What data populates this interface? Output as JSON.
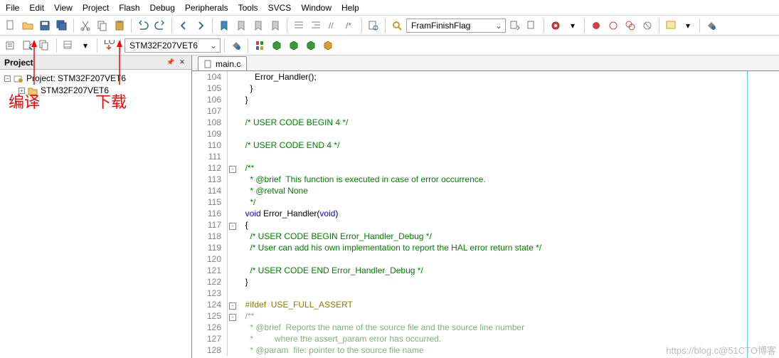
{
  "menu": [
    "File",
    "Edit",
    "View",
    "Project",
    "Flash",
    "Debug",
    "Peripherals",
    "Tools",
    "SVCS",
    "Window",
    "Help"
  ],
  "toolbar2": {
    "target": "STM32F207VET6"
  },
  "search": {
    "text": "FramFinishFlag"
  },
  "project": {
    "panel_title": "Project",
    "root": "Project: STM32F207VET6",
    "child": "STM32F207VET6"
  },
  "ann": {
    "compile": "编译",
    "download": "下载"
  },
  "tab": {
    "file": "main.c"
  },
  "code": [
    {
      "n": 104,
      "f": "",
      "t": "      Error_Handler();",
      "cls": ""
    },
    {
      "n": 105,
      "f": "",
      "t": "    }",
      "cls": ""
    },
    {
      "n": 106,
      "f": "",
      "t": "  }",
      "cls": ""
    },
    {
      "n": 107,
      "f": "",
      "t": "",
      "cls": ""
    },
    {
      "n": 108,
      "f": "",
      "t": "  /* USER CODE BEGIN 4 */",
      "cls": "c-cm"
    },
    {
      "n": 109,
      "f": "",
      "t": "",
      "cls": ""
    },
    {
      "n": 110,
      "f": "",
      "t": "  /* USER CODE END 4 */",
      "cls": "c-cm"
    },
    {
      "n": 111,
      "f": "",
      "t": "",
      "cls": ""
    },
    {
      "n": 112,
      "f": "m",
      "html": "  <span class='c-cm'>/**</span>"
    },
    {
      "n": 113,
      "f": "",
      "html": "  <span class='c-cm'>  * @brief  This function is executed in case of error occurrence.</span>"
    },
    {
      "n": 114,
      "f": "",
      "html": "  <span class='c-cm'>  * @retval None</span>"
    },
    {
      "n": 115,
      "f": "",
      "html": "  <span class='c-cm'>  */</span>"
    },
    {
      "n": 116,
      "f": "",
      "html": "  <span class='c-kw'>void</span> <span class='c-fn'>Error_Handler</span>(<span class='c-kw'>void</span>)"
    },
    {
      "n": 117,
      "f": "m",
      "t": "  {",
      "cls": ""
    },
    {
      "n": 118,
      "f": "",
      "html": "    <span class='c-cm'>/* USER CODE BEGIN Error_Handler_Debug */</span>"
    },
    {
      "n": 119,
      "f": "",
      "html": "    <span class='c-cm'>/* User can add his own implementation to report the HAL error return state */</span>"
    },
    {
      "n": 120,
      "f": "",
      "t": "",
      "cls": ""
    },
    {
      "n": 121,
      "f": "",
      "html": "    <span class='c-cm'>/* USER CODE END Error_Handler_Debug */</span>"
    },
    {
      "n": 122,
      "f": "",
      "t": "  }",
      "cls": ""
    },
    {
      "n": 123,
      "f": "",
      "t": "",
      "cls": ""
    },
    {
      "n": 124,
      "f": "m",
      "html": "  <span class='c-pp'>#ifdef  USE_FULL_ASSERT</span>"
    },
    {
      "n": 125,
      "f": "m",
      "html": "  <span class='c-cm2'>/**</span>"
    },
    {
      "n": 126,
      "f": "",
      "html": "  <span class='c-cm2'>  * @brief  Reports the name of the source file and the source line number</span>"
    },
    {
      "n": 127,
      "f": "",
      "html": "  <span class='c-cm2'>  *         where the assert_param error has occurred.</span>"
    },
    {
      "n": 128,
      "f": "",
      "html": "  <span class='c-cm2'>  * @param  file: pointer to the source file name</span>"
    }
  ],
  "watermark": "https://blog.c@51CTO博客"
}
